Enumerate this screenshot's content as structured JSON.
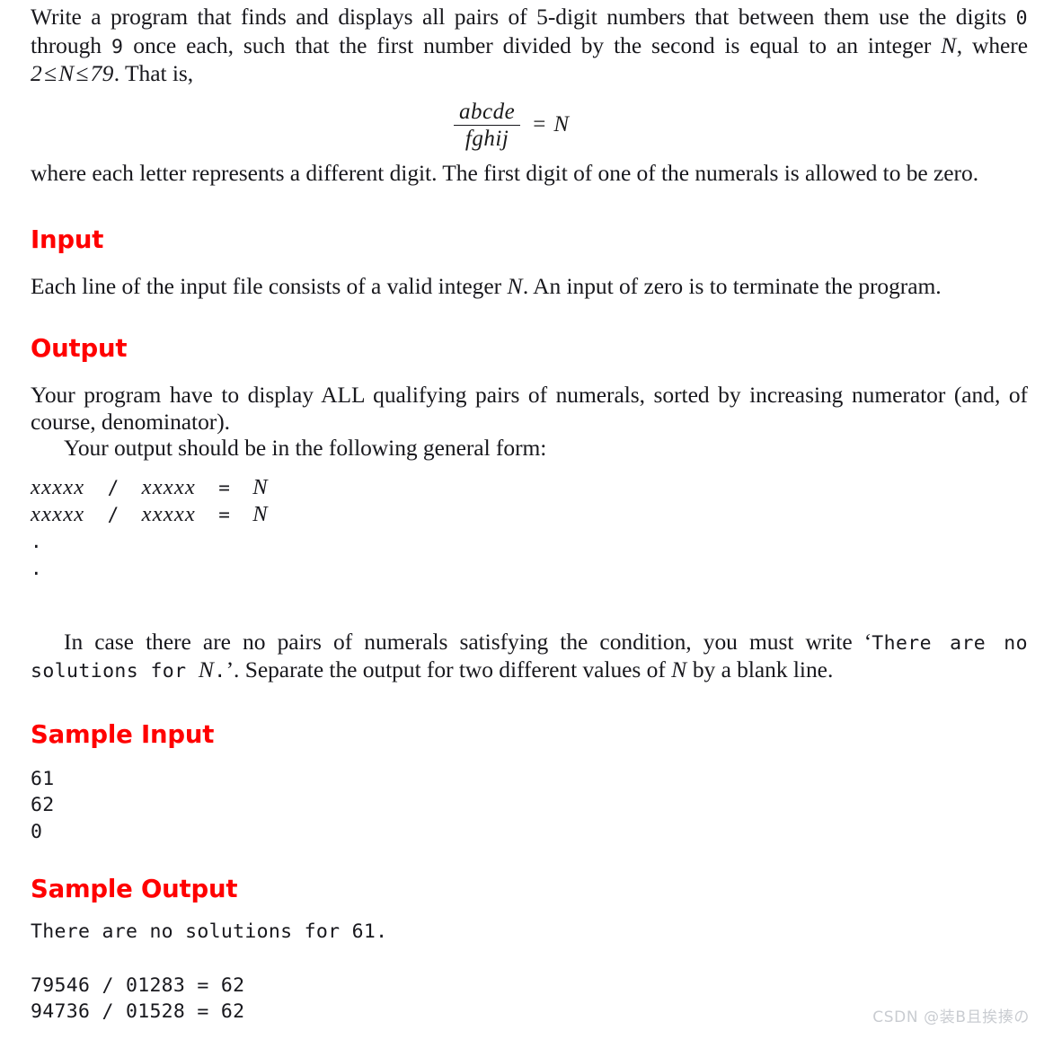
{
  "document": {
    "background_color": "#ffffff",
    "text_color": "#18181d",
    "heading_color": "#ff0000"
  },
  "intro": {
    "part1": "Write a program that finds and displays all pairs of 5-digit numbers that between them use the digits ",
    "digit_zero": "0",
    "part2": " through ",
    "digit_nine": "9",
    "part3": " once each, such that the first number divided by the second is equal to an integer ",
    "var_n": "N",
    "part4": ", where ",
    "range_lower": "2",
    "le1": "≤",
    "range_var": "N",
    "le2": "≤",
    "range_upper": "79",
    "part5": ". That is,"
  },
  "formula": {
    "numerator": "abcde",
    "denominator": "fghij",
    "equals": "=",
    "result": "N"
  },
  "after_formula": {
    "text": "where each letter represents a different digit.  The first digit of one of the numerals is allowed to be zero."
  },
  "sections": {
    "input": {
      "heading": "Input",
      "paragraph_part1": "Each line of the input file consists of a valid integer ",
      "paragraph_var": "N",
      "paragraph_part2": ". An input of zero is to terminate the program."
    },
    "output": {
      "heading": "Output",
      "paragraph1": "Your program have to display ALL qualifying pairs of numerals, sorted by increasing numerator (and, of course, denominator).",
      "paragraph2": "Your output should be in the following general form:",
      "format_lines": [
        {
          "x1": "xxxxx",
          "slash": "/",
          "x2": "xxxxx",
          "eq": "=",
          "n": "N"
        },
        {
          "x1": "xxxxx",
          "slash": "/",
          "x2": "xxxxx",
          "eq": "=",
          "n": "N"
        }
      ],
      "ellipsis_dots": [
        ".",
        "."
      ],
      "note_part1": "In case there are no pairs of numerals satisfying the condition, you must write ‘",
      "note_code_a": "There are no solutions for ",
      "note_code_var": "N",
      "note_code_b": ".",
      "note_part2": "’. Separate the output for two different values of ",
      "note_var": "N",
      "note_part3": " by a blank line."
    },
    "sample_input": {
      "heading": "Sample Input",
      "lines": [
        "61",
        "62",
        "0"
      ]
    },
    "sample_output": {
      "heading": "Sample Output",
      "block1": [
        "There are no solutions for 61."
      ],
      "block2": [
        "79546 / 01283 = 62",
        "94736 / 01528 = 62"
      ]
    }
  },
  "watermark": {
    "text": "CSDN @装B且挨揍の"
  }
}
